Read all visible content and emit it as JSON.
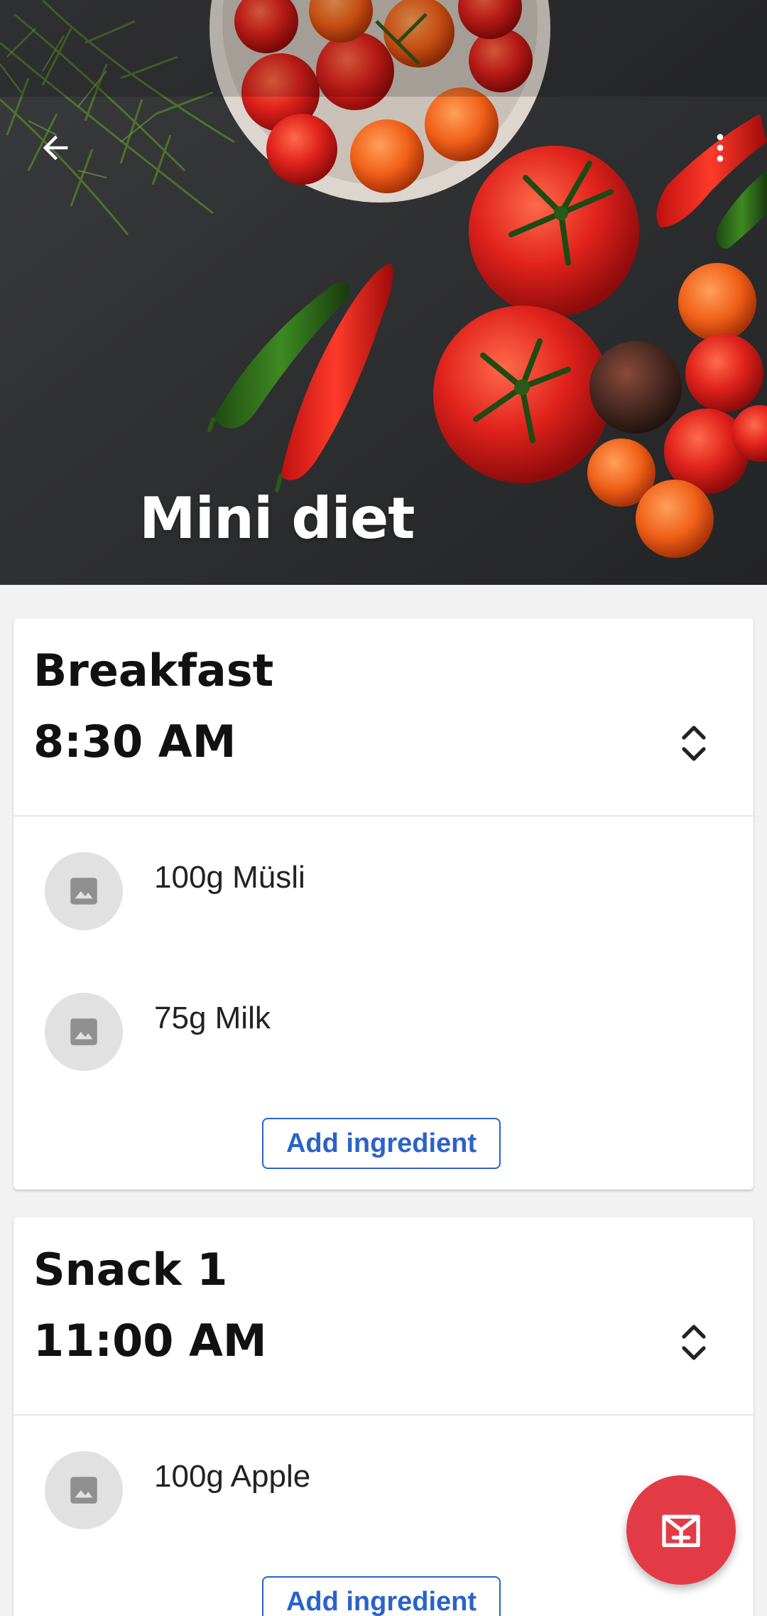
{
  "hero": {
    "title": "Mini diet",
    "back_icon": "arrow-left-icon",
    "more_icon": "more-vertical-icon"
  },
  "meals": [
    {
      "name": "Breakfast",
      "time": "8:30 AM",
      "ingredients": [
        {
          "label": "100g Müsli",
          "icon": "image-placeholder-icon"
        },
        {
          "label": "75g Milk",
          "icon": "image-placeholder-icon"
        }
      ],
      "add_label": "Add ingredient"
    },
    {
      "name": "Snack 1",
      "time": "11:00 AM",
      "ingredients": [
        {
          "label": "100g Apple",
          "icon": "image-placeholder-icon"
        }
      ],
      "add_label": "Add ingredient"
    }
  ],
  "fab": {
    "icon": "log-meal-icon"
  },
  "colors": {
    "accent": "#2a63c9",
    "fab": "#e33b46",
    "background": "#f2f2f3",
    "card": "#ffffff"
  }
}
